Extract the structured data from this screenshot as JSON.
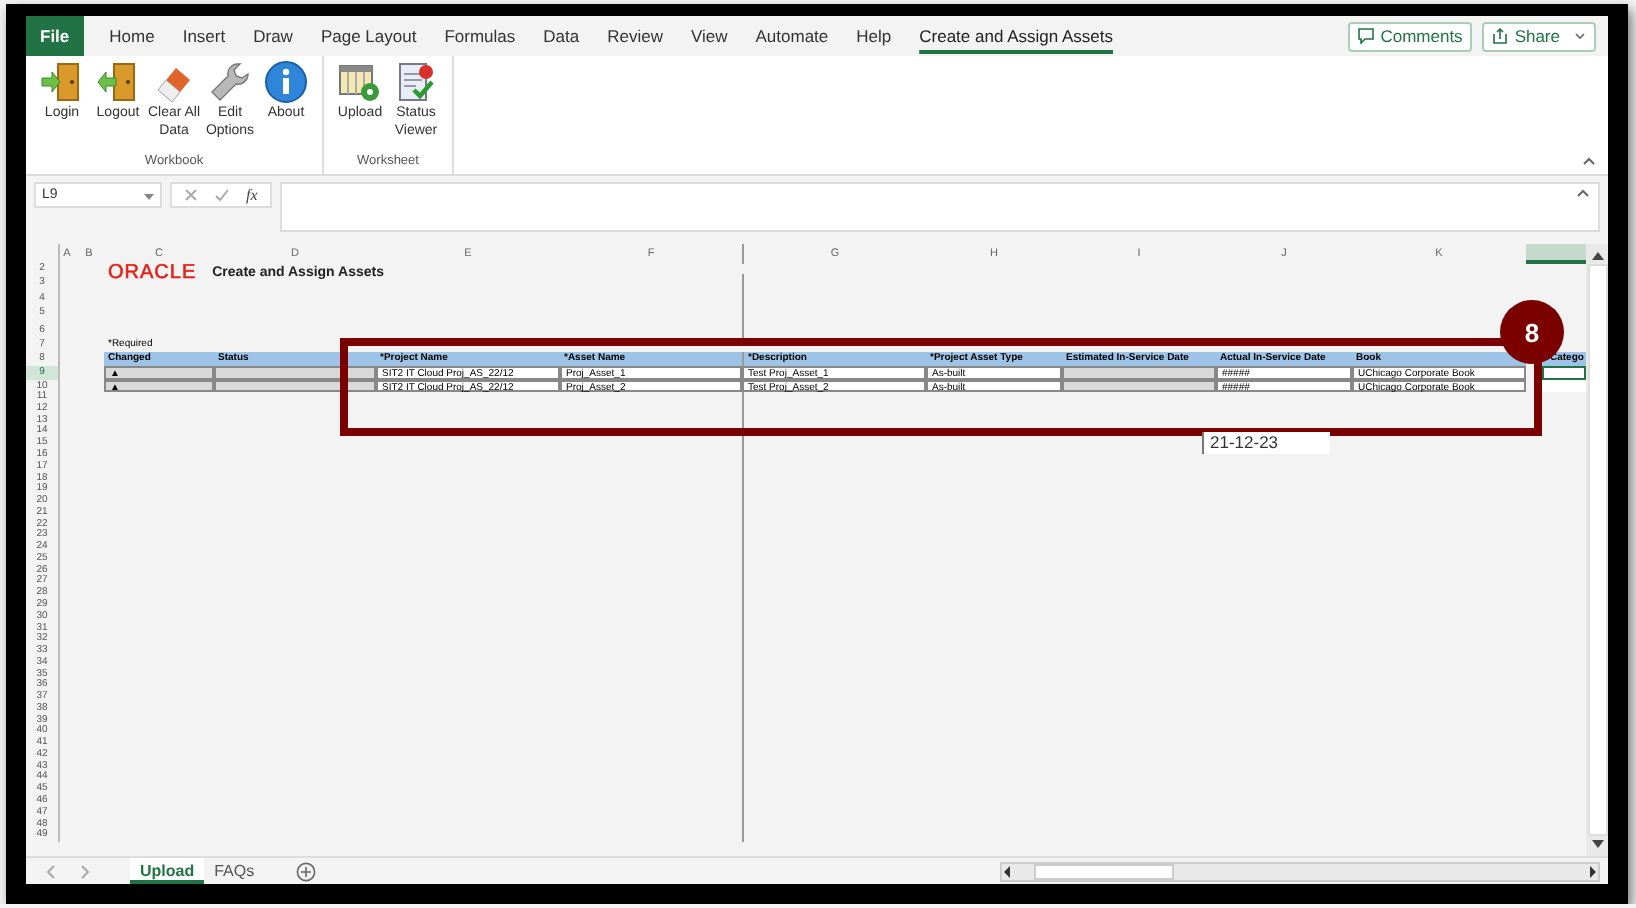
{
  "ribbon_tabs": [
    {
      "label": "File",
      "kind": "file",
      "selected": false
    },
    {
      "label": "Home",
      "kind": "tab",
      "selected": false
    },
    {
      "label": "Insert",
      "kind": "tab",
      "selected": false
    },
    {
      "label": "Draw",
      "kind": "tab",
      "selected": false
    },
    {
      "label": "Page Layout",
      "kind": "tab",
      "selected": false
    },
    {
      "label": "Formulas",
      "kind": "tab",
      "selected": false
    },
    {
      "label": "Data",
      "kind": "tab",
      "selected": false
    },
    {
      "label": "Review",
      "kind": "tab",
      "selected": false
    },
    {
      "label": "View",
      "kind": "tab",
      "selected": false
    },
    {
      "label": "Automate",
      "kind": "tab",
      "selected": false
    },
    {
      "label": "Help",
      "kind": "tab",
      "selected": false
    },
    {
      "label": "Create and Assign Assets",
      "kind": "tab",
      "selected": true
    }
  ],
  "header_buttons": [
    {
      "label": "Comments",
      "kind": "comments"
    },
    {
      "label": "Share",
      "kind": "share"
    }
  ],
  "ribbon_groups": [
    {
      "label": "Workbook",
      "buttons": [
        {
          "label": "Login",
          "kind": "login"
        },
        {
          "label": "Logout",
          "kind": "logout"
        },
        {
          "label": "Clear All Data",
          "kind": "clear"
        },
        {
          "label": "Edit Options",
          "kind": "edit"
        },
        {
          "label": "About",
          "kind": "about"
        }
      ]
    },
    {
      "label": "Worksheet",
      "buttons": [
        {
          "label": "Upload",
          "kind": "upload"
        },
        {
          "label": "Status Viewer",
          "kind": "status"
        }
      ]
    }
  ],
  "formula_bar": {
    "name_box": "L9",
    "function_label": "fx"
  },
  "columns": [
    {
      "label": "A",
      "selected": false
    },
    {
      "label": "B",
      "selected": false
    },
    {
      "label": "C",
      "selected": false
    },
    {
      "label": "D",
      "selected": false
    },
    {
      "label": "E",
      "selected": false
    },
    {
      "label": "F",
      "selected": false
    },
    {
      "label": "G",
      "selected": false
    },
    {
      "label": "H",
      "selected": false
    },
    {
      "label": "I",
      "selected": false
    },
    {
      "label": "J",
      "selected": false
    },
    {
      "label": "K",
      "selected": false
    },
    {
      "selected": true
    }
  ],
  "row_numbers": [
    {
      "label": "2",
      "selected": false
    },
    {
      "label": "3",
      "selected": false
    },
    {
      "label": "4",
      "selected": false
    },
    {
      "label": "5",
      "selected": false
    },
    {
      "label": "6",
      "selected": false
    },
    {
      "label": "7",
      "selected": false
    },
    {
      "label": "8",
      "selected": false
    },
    {
      "label": "9",
      "selected": true
    },
    {
      "label": "10",
      "selected": false
    },
    {
      "label": "11",
      "selected": false
    },
    {
      "label": "12",
      "selected": false
    },
    {
      "label": "13",
      "selected": false
    },
    {
      "label": "14",
      "selected": false
    },
    {
      "label": "15",
      "selected": false
    },
    {
      "label": "16",
      "selected": false
    },
    {
      "label": "17",
      "selected": false
    },
    {
      "label": "18",
      "selected": false
    },
    {
      "label": "19",
      "selected": false
    },
    {
      "label": "20",
      "selected": false
    },
    {
      "label": "21",
      "selected": false
    },
    {
      "label": "22",
      "selected": false
    },
    {
      "label": "23",
      "selected": false
    },
    {
      "label": "24",
      "selected": false
    },
    {
      "label": "25",
      "selected": false
    },
    {
      "label": "26",
      "selected": false
    },
    {
      "label": "27",
      "selected": false
    },
    {
      "label": "28",
      "selected": false
    },
    {
      "label": "29",
      "selected": false
    },
    {
      "label": "30",
      "selected": false
    },
    {
      "label": "31",
      "selected": false
    },
    {
      "label": "32",
      "selected": false
    },
    {
      "label": "33",
      "selected": false
    },
    {
      "label": "34",
      "selected": false
    },
    {
      "label": "35",
      "selected": false
    },
    {
      "label": "36",
      "selected": false
    },
    {
      "label": "37",
      "selected": false
    },
    {
      "label": "38",
      "selected": false
    },
    {
      "label": "39",
      "selected": false
    },
    {
      "label": "40",
      "selected": false
    },
    {
      "label": "41",
      "selected": false
    },
    {
      "label": "42",
      "selected": false
    },
    {
      "label": "43",
      "selected": false
    },
    {
      "label": "44",
      "selected": false
    },
    {
      "label": "45",
      "selected": false
    },
    {
      "label": "46",
      "selected": false
    },
    {
      "label": "47",
      "selected": false
    },
    {
      "label": "48",
      "selected": false
    },
    {
      "label": "49",
      "selected": false
    }
  ],
  "sheet": {
    "logo": "ORACLE",
    "title": "Create and Assign Assets",
    "required_note": "*Required",
    "headers": [
      "Changed",
      "Status",
      "*Project Name",
      "*Asset Name",
      "*Description",
      "*Project Asset Type",
      "Estimated In-Service Date",
      "Actual In-Service Date",
      "Book",
      "Catego"
    ],
    "rows": [
      {
        "changed": "▲",
        "project_name": "SIT2 IT Cloud Proj_AS_22/12",
        "asset_name": "Proj_Asset_1",
        "description": "Test Proj_Asset_1",
        "asset_type": "As-built",
        "actual_date": "#####",
        "book": "UChicago Corporate Book",
        "selected": true
      },
      {
        "changed": "▲",
        "project_name": "SIT2 IT Cloud Proj_AS_22/12",
        "asset_name": "Proj_Asset_2",
        "description": "Test Proj_Asset_2",
        "asset_type": "As-built",
        "actual_date": "#####",
        "book": "UChicago Corporate Book",
        "selected": false
      }
    ]
  },
  "callout": {
    "number": "8"
  },
  "tooltip": {
    "text": "21-12-23"
  },
  "sheet_tabs": [
    {
      "label": "Upload",
      "selected": true
    },
    {
      "label": "FAQs",
      "selected": false
    }
  ]
}
